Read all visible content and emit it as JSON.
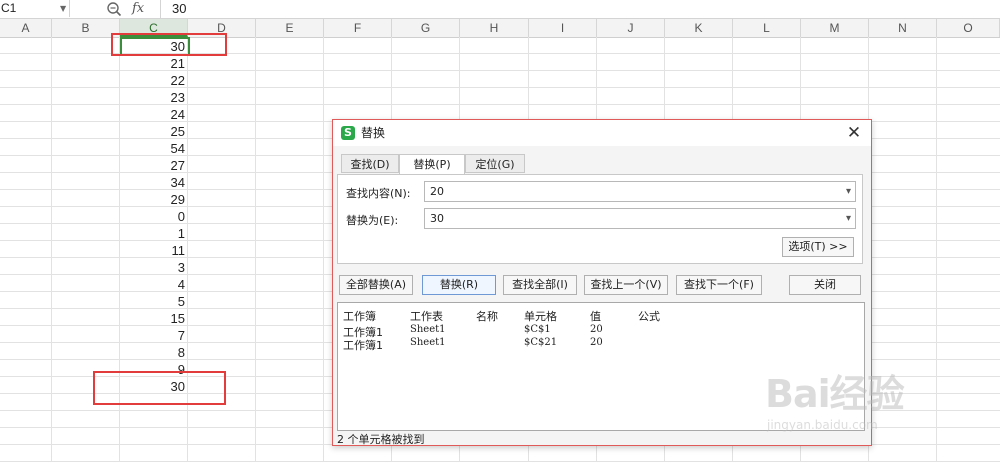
{
  "formula_bar": {
    "cell_ref": "C1",
    "fx_label": "fx",
    "content": "30"
  },
  "columns": [
    "A",
    "B",
    "C",
    "D",
    "E",
    "F",
    "G",
    "H",
    "I",
    "J",
    "K",
    "L",
    "M",
    "N",
    "O"
  ],
  "column_c_values": [
    "30",
    "21",
    "22",
    "23",
    "24",
    "25",
    "54",
    "27",
    "34",
    "29",
    "0",
    "1",
    "11",
    "3",
    "4",
    "5",
    "15",
    "7",
    "8",
    "9",
    "30"
  ],
  "dialog": {
    "title": "替换",
    "close": "✕",
    "tabs": [
      "查找(D)",
      "替换(P)",
      "定位(G)"
    ],
    "find_label": "查找内容(N):",
    "find_value": "20",
    "replace_label": "替换为(E):",
    "replace_value": "30",
    "options_button": "选项(T) >>",
    "buttons": {
      "replace_all": "全部替换(A)",
      "replace": "替换(R)",
      "find_all": "查找全部(I)",
      "find_prev": "查找上一个(V)",
      "find_next": "查找下一个(F)",
      "close": "关闭"
    },
    "results": {
      "headers": [
        "工作簿",
        "工作表",
        "名称",
        "单元格",
        "值",
        "公式"
      ],
      "rows": [
        [
          "工作簿1",
          "Sheet1",
          "",
          "$C$1",
          "20",
          ""
        ],
        [
          "工作簿1",
          "Sheet1",
          "",
          "$C$21",
          "20",
          ""
        ]
      ]
    },
    "status": "2 个单元格被找到"
  },
  "watermark": {
    "brand": "Bai经验",
    "url": "jingyan.baidu.com"
  },
  "colors": {
    "active_border": "#3b8e3b",
    "highlight_red": "#e23c3c",
    "app_icon": "#2aa84a"
  }
}
